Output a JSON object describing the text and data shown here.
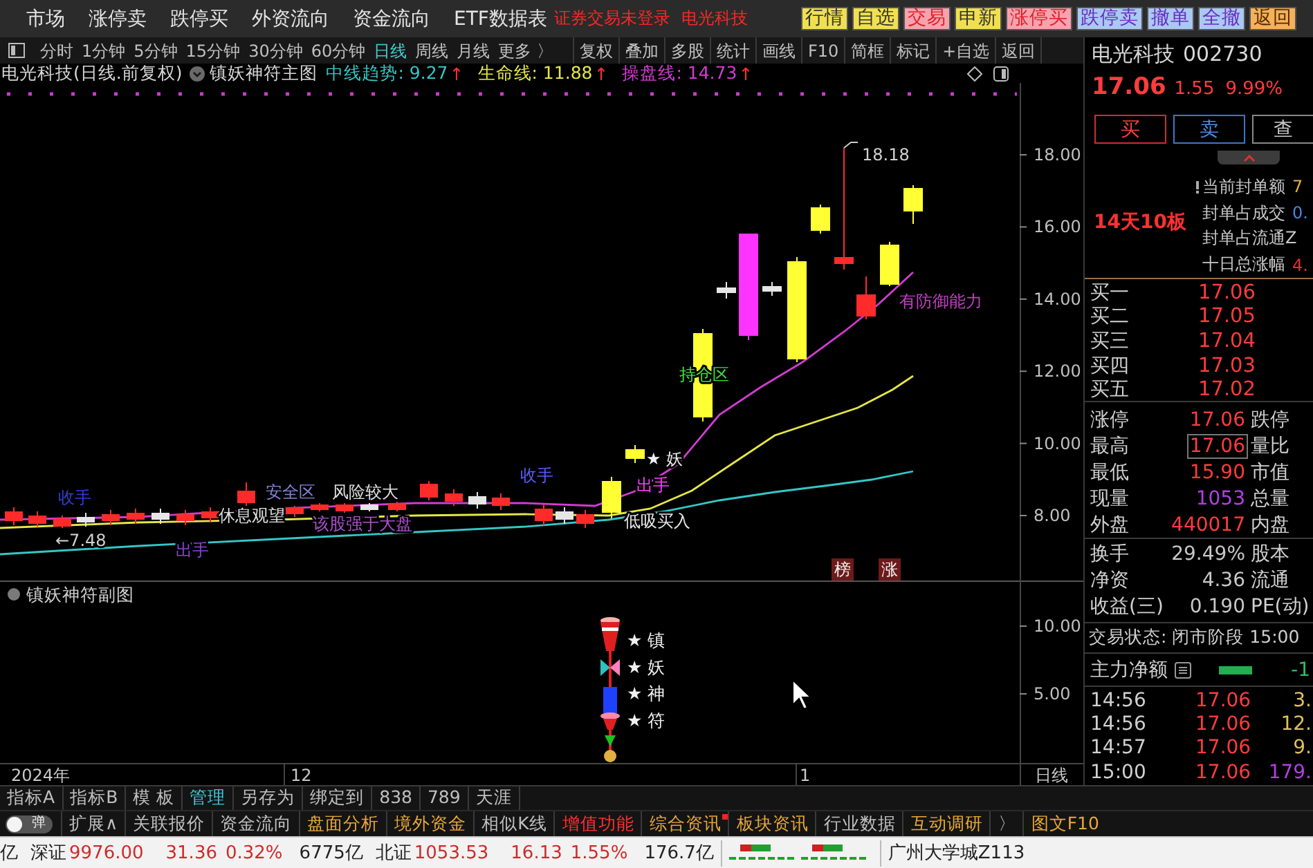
{
  "top_menu": {
    "items": [
      "市场",
      "涨停卖",
      "跌停买",
      "外资流向",
      "资金流向",
      "ETF数据表"
    ],
    "login_status": "证券交易未登录",
    "stock_name": "电光科技",
    "quick_buttons": [
      {
        "label": "行情",
        "kind": "info"
      },
      {
        "label": "自选",
        "kind": "info"
      },
      {
        "label": "交易",
        "kind": "trade"
      },
      {
        "label": "申新",
        "kind": "info"
      },
      {
        "label": "涨停买",
        "kind": "trade"
      },
      {
        "label": "跌停卖",
        "kind": "cancel"
      },
      {
        "label": "撤单",
        "kind": "cancel"
      },
      {
        "label": "全撤",
        "kind": "cancel"
      },
      {
        "label": "返回",
        "kind": "exit"
      }
    ]
  },
  "toolbar": {
    "periods": [
      {
        "label": "分时",
        "selected": false
      },
      {
        "label": "1分钟",
        "selected": false
      },
      {
        "label": "5分钟",
        "selected": false
      },
      {
        "label": "15分钟",
        "selected": false
      },
      {
        "label": "30分钟",
        "selected": false
      },
      {
        "label": "60分钟",
        "selected": false
      },
      {
        "label": "日线",
        "selected": true
      },
      {
        "label": "周线",
        "selected": false
      },
      {
        "label": "月线",
        "selected": false
      },
      {
        "label": "更多 〉",
        "selected": false
      }
    ],
    "tools": [
      "复权",
      "叠加",
      "多股",
      "统计",
      "画线",
      "F10",
      "简框",
      "标记",
      "+自选",
      "返回"
    ]
  },
  "chart": {
    "title": "电光科技(日线.前复权)",
    "indicator": "镇妖神符主图",
    "legends": [
      {
        "label": "中线趋势: 9.27",
        "arrow": "↑",
        "color": "#36c6c6"
      },
      {
        "label": "生命线: 11.88",
        "arrow": "↑",
        "color": "#e6e64a"
      },
      {
        "label": "操盘线: 14.73",
        "arrow": "↑",
        "color": "#d23cd2"
      }
    ],
    "price_ticks": [
      "18.00",
      "16.00",
      "14.00",
      "12.00",
      "10.00",
      "8.00"
    ],
    "high_label": "18.18",
    "low_label": "←7.48",
    "annotations": [
      {
        "text": "收手",
        "color": "#2e3ed6"
      },
      {
        "text": "出手",
        "color": "#8a44d0"
      },
      {
        "text": "休息观望",
        "color": "#e0e0e0"
      },
      {
        "text": "安全区",
        "color": "#8484d8"
      },
      {
        "text": "风险较大",
        "color": "#e0e0e0"
      },
      {
        "text": "该股强于大盘",
        "color": "#b050d0"
      },
      {
        "text": "收手",
        "color": "#5a5aff"
      },
      {
        "text": "★ 妖",
        "color": "#f0f0f0"
      },
      {
        "text": "出手",
        "color": "#ff40ff"
      },
      {
        "text": "低吸买入",
        "color": "#e8e8e8"
      },
      {
        "text": "持仓区",
        "color": "#40e040"
      },
      {
        "text": "有防御能力",
        "color": "#c040c0"
      }
    ],
    "badges": [
      "榜",
      "涨"
    ]
  },
  "sub_chart": {
    "title": "镇妖神符副图",
    "ticks": [
      "10.00",
      "5.00"
    ],
    "signals": [
      "★ 镇",
      "★ 妖",
      "★ 神",
      "★ 符"
    ]
  },
  "date_axis": {
    "labels": [
      "2024年",
      "12",
      "1"
    ],
    "period": "日线"
  },
  "quote_panel": {
    "name": "电光科技",
    "code": "002730",
    "price": "17.06",
    "change": "1.55",
    "percent": "9.99%",
    "actions": [
      {
        "label": "买",
        "kind": "buy"
      },
      {
        "label": "卖",
        "kind": "sell"
      },
      {
        "label": "查",
        "kind": "query"
      }
    ],
    "streak": "14天10板",
    "seal_rows": [
      {
        "label": "当前封单额",
        "value": "7",
        "color": "#e0b040"
      },
      {
        "label": "封单占成交",
        "value": "0.",
        "color": "#4a86e0"
      },
      {
        "label": "封单占流通Z"
      },
      {
        "label": "十日总涨幅",
        "value": "4.",
        "color": "#e03030"
      }
    ],
    "bids": [
      {
        "label": "买一",
        "price": "17.06"
      },
      {
        "label": "买二",
        "price": "17.05"
      },
      {
        "label": "买三",
        "price": "17.04"
      },
      {
        "label": "买四",
        "price": "17.03"
      },
      {
        "label": "买五",
        "price": "17.02"
      }
    ],
    "stats": [
      {
        "label": "涨停",
        "value": "17.06",
        "next": "跌停",
        "kind": "up",
        "highlighted": false
      },
      {
        "label": "最高",
        "value": "17.06",
        "next": "量比",
        "kind": "up",
        "highlighted": true
      },
      {
        "label": "最低",
        "value": "15.90",
        "next": "市值",
        "kind": "up",
        "highlighted": false
      },
      {
        "label": "现量",
        "value": "1053",
        "next": "总量",
        "kind": "volume",
        "highlighted": false
      },
      {
        "label": "外盘",
        "value": "440017",
        "next": "内盘",
        "kind": "up",
        "highlighted": false
      }
    ],
    "fundamentals": [
      {
        "label": "换手",
        "value": "29.49%",
        "next": "股本"
      },
      {
        "label": "净资",
        "value": "4.36",
        "next": "流通"
      },
      {
        "label": "收益(三)",
        "value": "0.190",
        "next": "PE(动)"
      }
    ],
    "trade_status": "交易状态: 闭市阶段 15:00",
    "main_flow": {
      "label": "主力净额",
      "value": "-1"
    },
    "ticks": [
      {
        "time": "14:56",
        "price": "17.06",
        "volume": "3.",
        "kind": "normal"
      },
      {
        "time": "14:56",
        "price": "17.06",
        "volume": "12.",
        "kind": "normal"
      },
      {
        "time": "14:57",
        "price": "17.06",
        "volume": "9.",
        "kind": "normal"
      },
      {
        "time": "15:00",
        "price": "17.06",
        "volume": "179.",
        "kind": "large"
      }
    ]
  },
  "bottom_tabs": {
    "row1": [
      {
        "label": "指标A",
        "selected": false
      },
      {
        "label": "指标B",
        "selected": false
      },
      {
        "label": "模 板",
        "selected": false
      },
      {
        "label": "管理",
        "selected": true
      },
      {
        "label": "另存为",
        "selected": false
      },
      {
        "label": "绑定到",
        "selected": false
      },
      {
        "label": "838",
        "selected": false
      },
      {
        "label": "789",
        "selected": false
      },
      {
        "label": "天涯",
        "selected": false
      }
    ],
    "toggle": {
      "label": "弹",
      "on": false
    },
    "row2": [
      {
        "label": "扩展∧",
        "kind": "plain",
        "new": false
      },
      {
        "label": "关联报价",
        "kind": "plain",
        "new": false
      },
      {
        "label": "资金流向",
        "kind": "plain",
        "new": false
      },
      {
        "label": "盘面分析",
        "kind": "featured",
        "new": false
      },
      {
        "label": "境外资金",
        "kind": "featured",
        "new": false
      },
      {
        "label": "相似K线",
        "kind": "plain",
        "new": false
      },
      {
        "label": "增值功能",
        "kind": "premium",
        "new": false
      },
      {
        "label": "综合资讯",
        "kind": "featured",
        "new": true
      },
      {
        "label": "板块资讯",
        "kind": "featured",
        "new": false
      },
      {
        "label": "行业数据",
        "kind": "plain",
        "new": false
      },
      {
        "label": "互动调研",
        "kind": "featured",
        "new": false
      },
      {
        "label": "〉",
        "kind": "plain",
        "new": false
      },
      {
        "label": "图文F10",
        "kind": "featured",
        "new": false
      }
    ]
  },
  "status_bar": {
    "lead": "亿",
    "indices": [
      {
        "name": "深证",
        "value": "9976.00",
        "change": "31.36",
        "percent": "0.32%",
        "amount": "6775亿"
      },
      {
        "name": "北证",
        "value": "1053.53",
        "change": "16.13",
        "percent": "1.55%",
        "amount": "176.7亿"
      }
    ],
    "server": "广州大学城Z113"
  }
}
